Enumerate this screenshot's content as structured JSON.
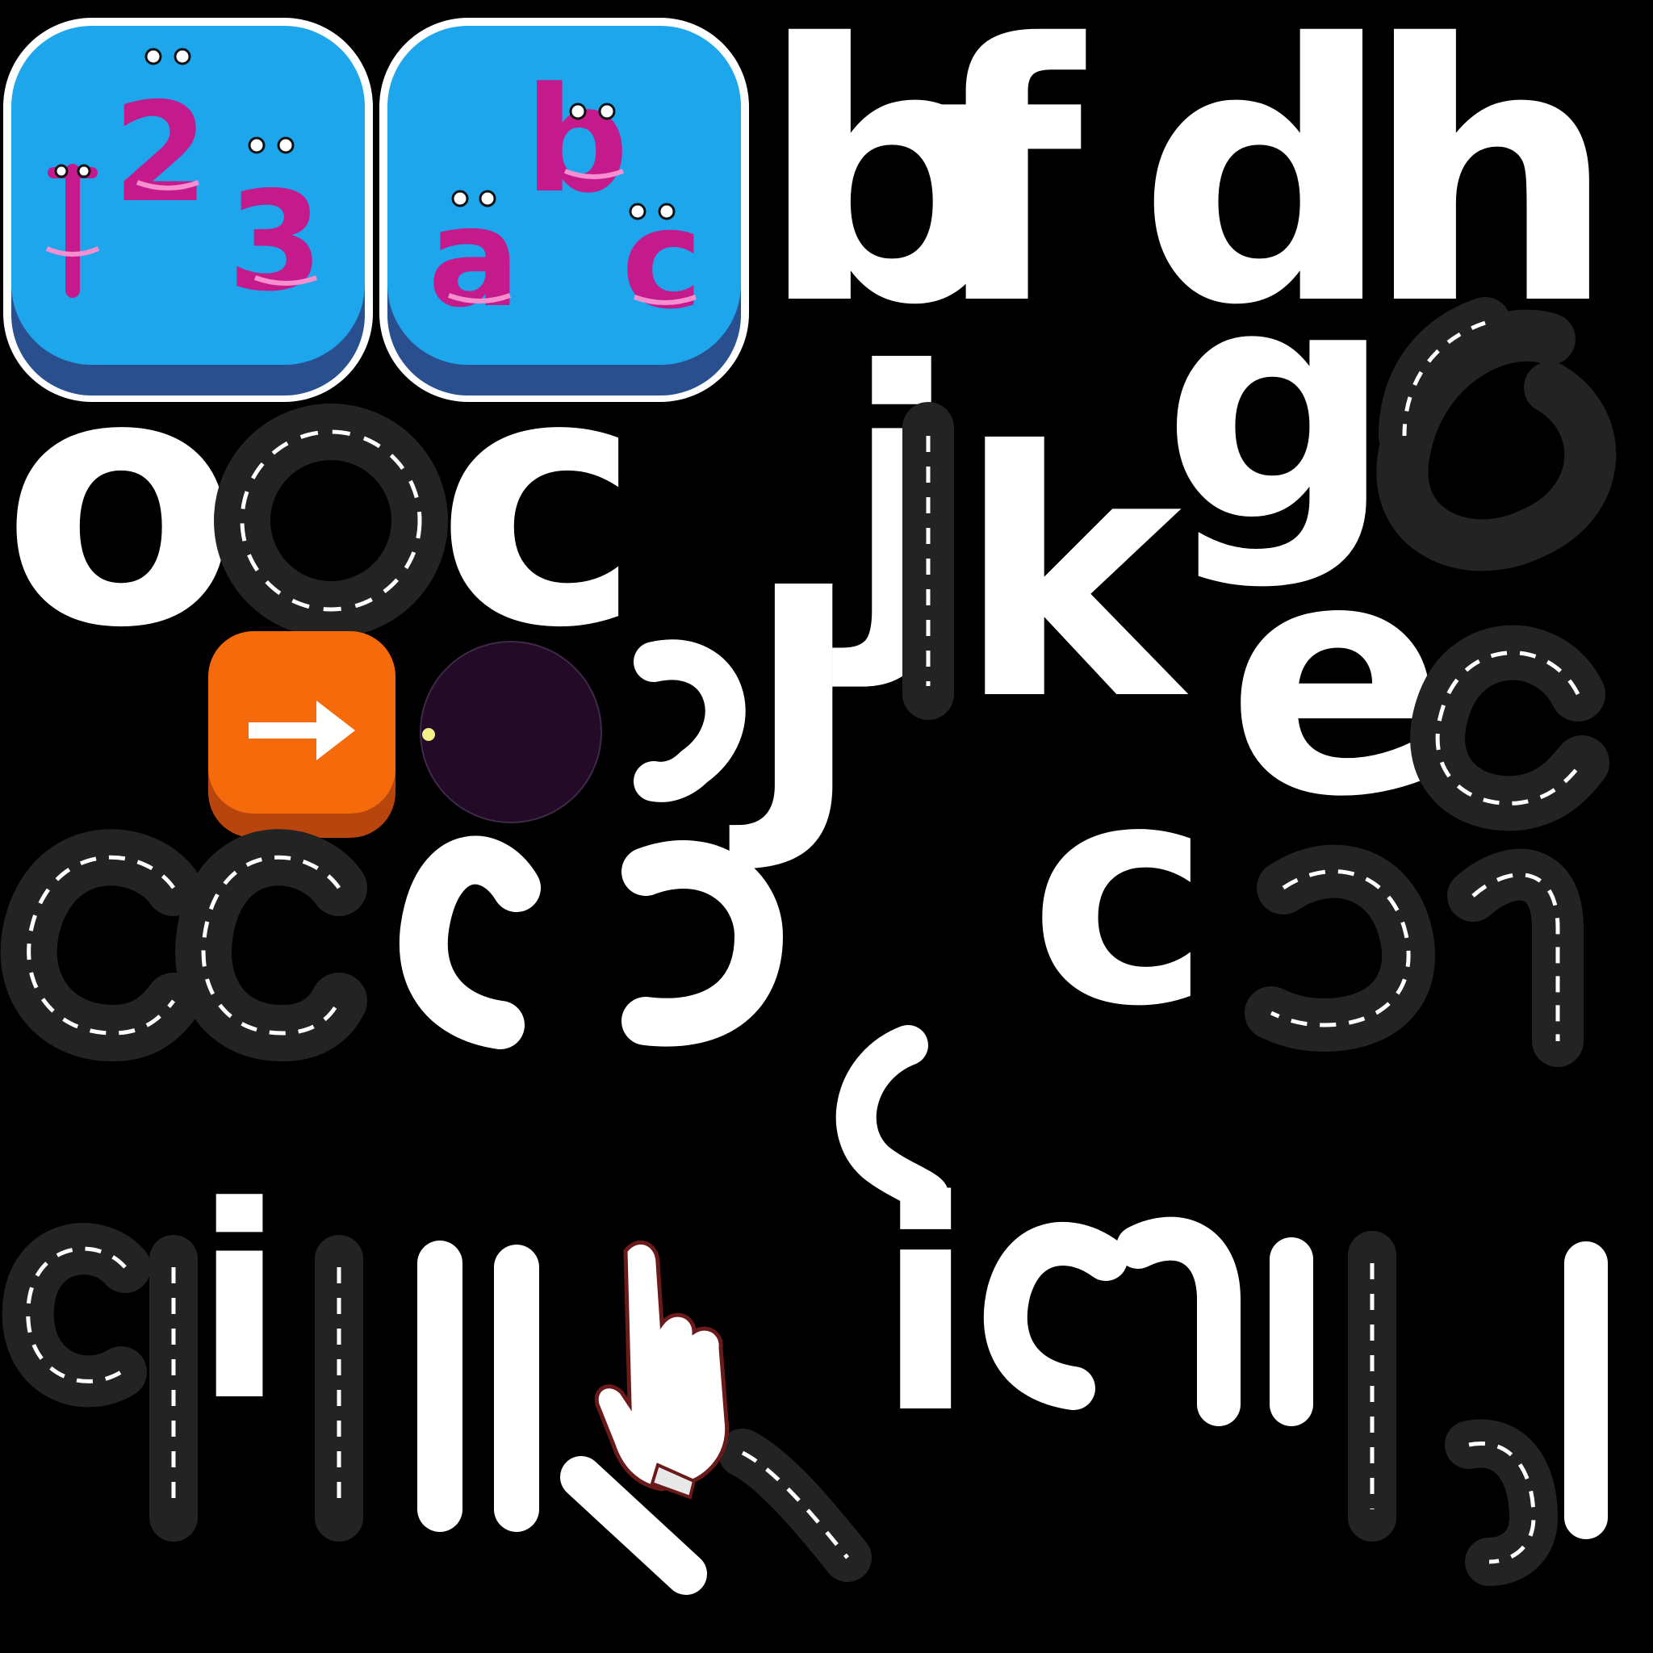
{
  "sprite_sheet": {
    "buttons": {
      "numbers_button": {
        "label_1": "1",
        "label_2": "2",
        "label_3": "3",
        "icon": "numbers-icon"
      },
      "letters_button": {
        "label_a": "a",
        "label_b": "b",
        "label_c": "c",
        "icon": "letters-icon"
      },
      "next_button": {
        "icon": "arrow-right-icon"
      }
    },
    "glyphs": {
      "b": "b",
      "f": "f",
      "d": "d",
      "h": "h",
      "g": "g",
      "o": "o",
      "c": "c",
      "j": "j",
      "k": "k",
      "e": "e",
      "i": "i",
      "l": "l"
    },
    "hand_pointer": {
      "icon": "hand-pointer-icon"
    },
    "colors": {
      "button_blue": "#1da6ec",
      "button_blue_shadow": "#2a4f8f",
      "letter_magenta": "#c41a8c",
      "button_orange": "#f56a0a",
      "button_orange_shadow": "#b8440e",
      "track_dark": "#232323",
      "track_dash": "#ffffff",
      "dot_purple": "#230b28",
      "dot_marker": "#f3f08a"
    }
  }
}
